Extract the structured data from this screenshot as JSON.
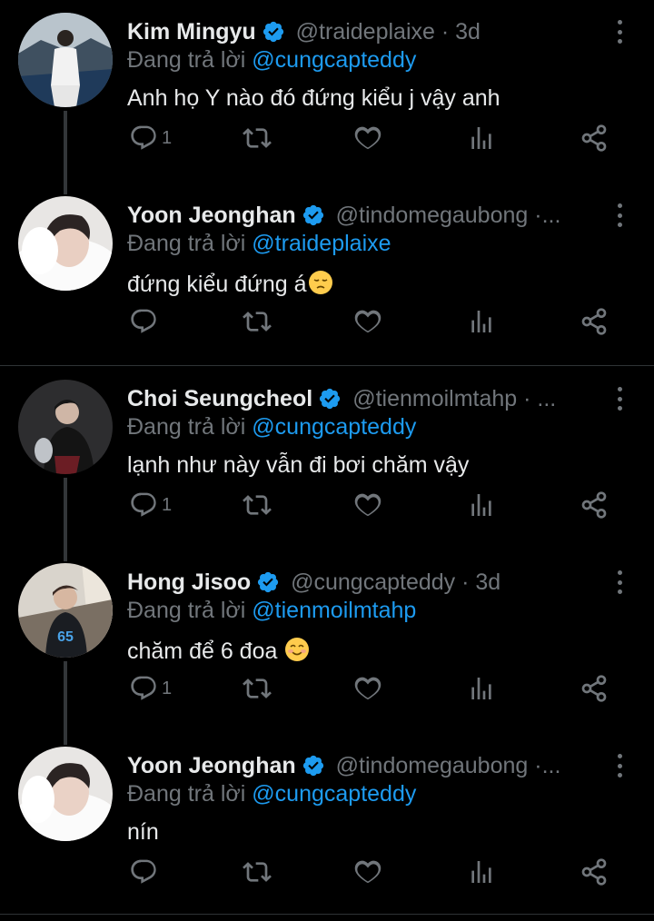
{
  "reply_prefix": "Đang trả lời",
  "tweets": [
    {
      "name": "Kim Mingyu",
      "handle": "@traideplaixe · 3d",
      "reply_to": "@cungcapteddy",
      "text": "Anh họ Y nào đó đứng kiểu j vậy anh",
      "reply_count": "1",
      "avatar": "person-by-sea-avatar"
    },
    {
      "name": "Yoon Jeonghan",
      "handle": "@tindomegaubong ·...",
      "reply_to": "@traideplaixe",
      "text": "đứng kiểu đứng á",
      "emoji": "pensive-face",
      "reply_count": "",
      "avatar": "person-in-fur-avatar"
    },
    {
      "name": "Choi Seungcheol",
      "handle": "@tienmoilmtahp · ...",
      "reply_to": "@cungcapteddy",
      "text": "lạnh như này vẫn đi bơi chăm vậy",
      "reply_count": "1",
      "avatar": "person-seated-dark-avatar"
    },
    {
      "name": "Hong Jisoo",
      "handle": "@cungcapteddy · 3d",
      "reply_to": "@tienmoilmtahp",
      "text": "chăm để 6 đoa",
      "emoji": "smiling-face",
      "reply_count": "1",
      "avatar": "person-in-jersey-avatar"
    },
    {
      "name": "Yoon Jeonghan",
      "handle": "@tindomegaubong ·...",
      "reply_to": "@cungcapteddy",
      "text": "nín",
      "reply_count": "",
      "avatar": "person-in-fur-avatar"
    }
  ],
  "colors": {
    "background": "#000000",
    "link": "#1d9bf0",
    "muted": "#71767b",
    "verified": "#1d9bf0"
  },
  "icons": [
    "reply-icon",
    "retweet-icon",
    "like-icon",
    "stats-icon",
    "share-icon",
    "verified-icon",
    "more-icon"
  ]
}
